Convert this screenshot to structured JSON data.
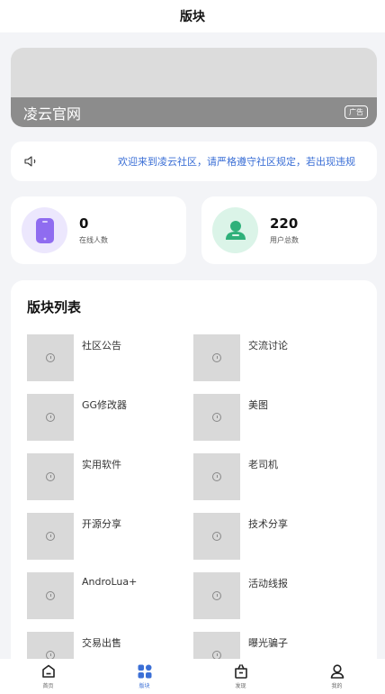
{
  "header": {
    "title": "版块"
  },
  "banner": {
    "name": "凌云官网",
    "ad_label": "广告"
  },
  "notice": {
    "icon": "speaker-icon",
    "text": "欢迎来到凌云社区，请严格遵守社区规定，若出现违规"
  },
  "stats": [
    {
      "value": "0",
      "label": "在线人数",
      "icon": "phone-icon",
      "color": "#8f6cf0"
    },
    {
      "value": "220",
      "label": "用户总数",
      "icon": "user-icon",
      "color": "#2fb07a"
    }
  ],
  "section": {
    "title": "版块列表",
    "items": [
      "社区公告",
      "交流讨论",
      "GG修改器",
      "美图",
      "实用软件",
      "老司机",
      "开源分享",
      "技术分享",
      "AndroLua+",
      "活动线报",
      "交易出售",
      "曝光骗子"
    ]
  },
  "tabbar": {
    "active": 1,
    "tabs": [
      {
        "label": "首页",
        "icon": "home-icon"
      },
      {
        "label": "版块",
        "icon": "grid-icon"
      },
      {
        "label": "发现",
        "icon": "discover-icon"
      },
      {
        "label": "我的",
        "icon": "profile-icon"
      }
    ]
  }
}
